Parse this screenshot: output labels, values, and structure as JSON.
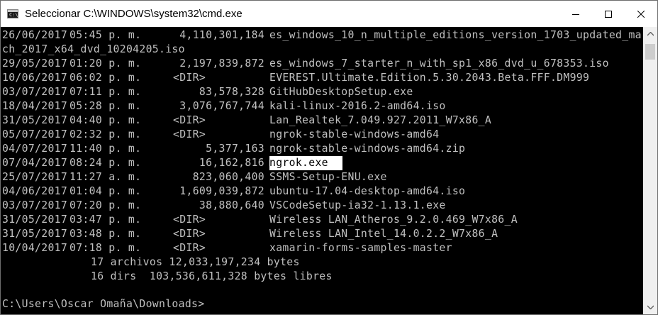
{
  "window": {
    "title": "Seleccionar C:\\WINDOWS\\system32\\cmd.exe",
    "app_icon_glyph": "C:\\",
    "controls": [
      "minimize-icon",
      "maximize-icon",
      "close-icon"
    ]
  },
  "listing": [
    {
      "date": "26/06/2017",
      "time": "05:45 p. m.",
      "size": "4,110,301,184",
      "name": "es_windows_10_n_multiple_editions_version_1703_updated_mar"
    },
    {
      "wrap": "ch_2017_x64_dvd_10204205.iso"
    },
    {
      "date": "29/05/2017",
      "time": "01:20 p. m.",
      "size": "2,197,839,872",
      "name": "es_windows_7_starter_n_with_sp1_x86_dvd_u_678353.iso"
    },
    {
      "date": "10/06/2017",
      "time": "06:02 p. m.",
      "size": "<DIR>",
      "name": "EVEREST.Ultimate.Edition.5.30.2043.Beta.FFF.DM999"
    },
    {
      "date": "03/07/2017",
      "time": "07:11 p. m.",
      "size": "83,578,328",
      "name": "GitHubDesktopSetup.exe"
    },
    {
      "date": "18/04/2017",
      "time": "05:28 p. m.",
      "size": "3,076,767,744",
      "name": "kali-linux-2016.2-amd64.iso"
    },
    {
      "date": "31/05/2017",
      "time": "04:40 p. m.",
      "size": "<DIR>",
      "name": "Lan_Realtek_7.049.927.2011_W7x86_A"
    },
    {
      "date": "05/07/2017",
      "time": "02:32 p. m.",
      "size": "<DIR>",
      "name": "ngrok-stable-windows-amd64"
    },
    {
      "date": "04/07/2017",
      "time": "11:40 p. m.",
      "size": "5,377,163",
      "name": "ngrok-stable-windows-amd64.zip"
    },
    {
      "date": "07/04/2017",
      "time": "08:24 p. m.",
      "size": "16,162,816",
      "name": "ngrok.exe",
      "selected": true
    },
    {
      "date": "25/07/2017",
      "time": "11:27 a. m.",
      "size": "823,060,400",
      "name": "SSMS-Setup-ENU.exe"
    },
    {
      "date": "04/06/2017",
      "time": "01:04 p. m.",
      "size": "1,609,039,872",
      "name": "ubuntu-17.04-desktop-amd64.iso"
    },
    {
      "date": "03/07/2017",
      "time": "07:20 p. m.",
      "size": "38,880,640",
      "name": "VSCodeSetup-ia32-1.13.1.exe"
    },
    {
      "date": "31/05/2017",
      "time": "03:47 p. m.",
      "size": "<DIR>",
      "name": "Wireless LAN_Atheros_9.2.0.469_W7x86_A"
    },
    {
      "date": "31/05/2017",
      "time": "03:48 p. m.",
      "size": "<DIR>",
      "name": "Wireless LAN_Intel_14.0.2.2_W7x86_A"
    },
    {
      "date": "10/04/2017",
      "time": "07:18 p. m.",
      "size": "<DIR>",
      "name": "xamarin-forms-samples-master"
    }
  ],
  "summary": {
    "files_line": "17 archivos 12,033,197,234 bytes",
    "dirs_line": "16 dirs  103,536,611,328 bytes libres"
  },
  "prompt": "C:\\Users\\Oscar Omaña\\Downloads>"
}
